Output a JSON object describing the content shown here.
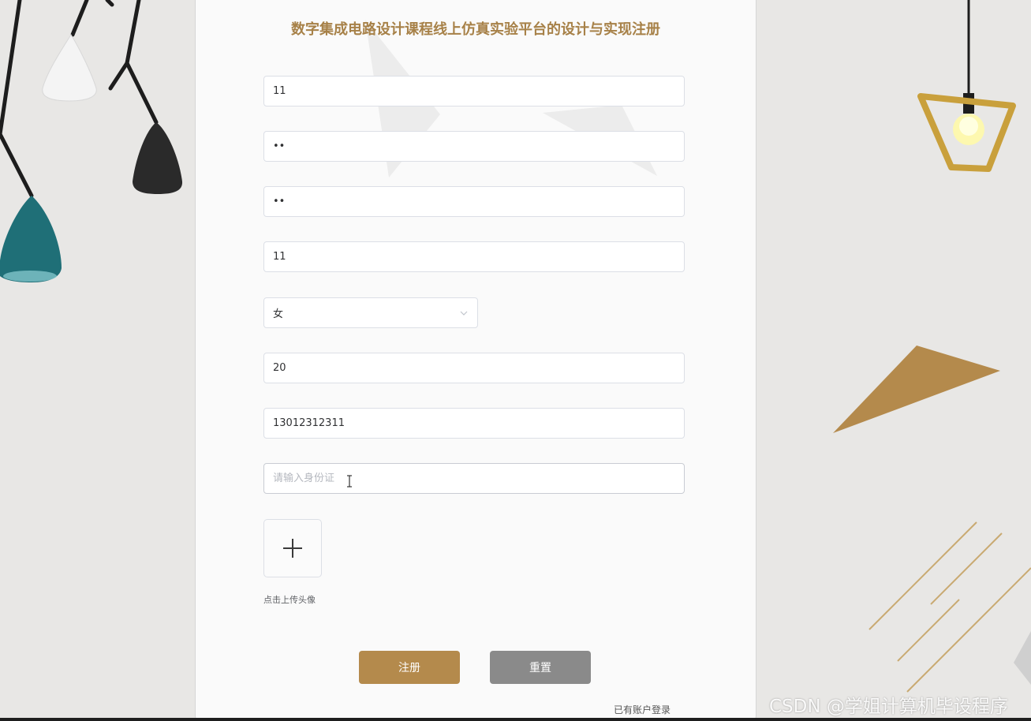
{
  "form": {
    "title": "数字集成电路设计课程线上仿真实验平台的设计与实现注册",
    "fields": [
      {
        "value": "11",
        "type": "text"
      },
      {
        "value": "••",
        "type": "text"
      },
      {
        "value": "••",
        "type": "text"
      },
      {
        "value": "11",
        "type": "text"
      }
    ],
    "gender": {
      "selected": "女"
    },
    "age": {
      "value": "20"
    },
    "phone": {
      "value": "13012312311"
    },
    "id_card": {
      "value": "",
      "placeholder": "请输入身份证"
    },
    "avatar": {
      "hint": "点击上传头像"
    },
    "buttons": {
      "register": "注册",
      "reset": "重置"
    },
    "login_link": "已有账户登录"
  },
  "watermark": "CSDN @学姐计算机毕设程序",
  "colors": {
    "title": "#a78148",
    "register_button": "#b48a4c",
    "reset_button": "#8a8a8a",
    "background": "#e8e7e5"
  },
  "icons": {
    "upload": "plus-icon",
    "select": "chevron-down-icon"
  }
}
